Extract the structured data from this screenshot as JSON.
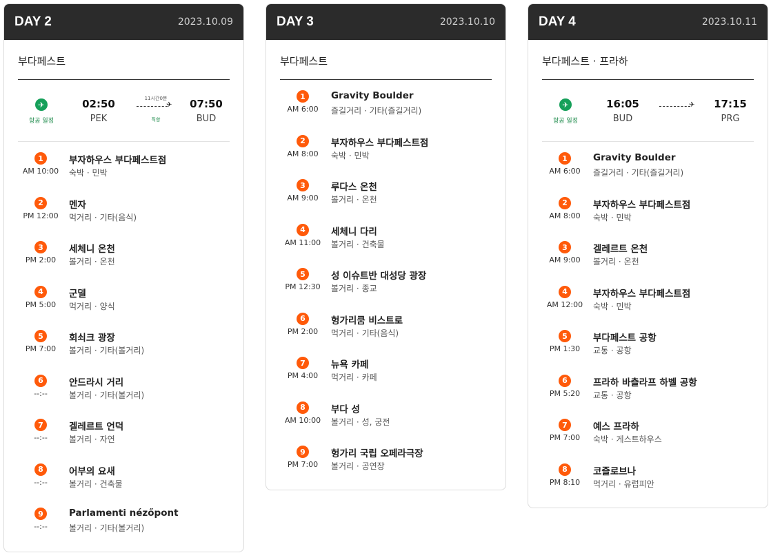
{
  "days": [
    {
      "day": "DAY 2",
      "date": "2023.10.09",
      "city": "부다페스트",
      "flight": {
        "label": "항공 일정",
        "dep_time": "02:50",
        "dep_code": "PEK",
        "arr_time": "07:50",
        "arr_code": "BUD",
        "duration": "11시간0분",
        "direct": "직항"
      },
      "stops": [
        {
          "num": "1",
          "time": "AM 10:00",
          "name": "부자하우스 부다페스트점",
          "category": "숙박 · 민박"
        },
        {
          "num": "2",
          "time": "PM 12:00",
          "name": "멘자",
          "category": "먹거리 · 기타(음식)"
        },
        {
          "num": "3",
          "time": "PM 2:00",
          "name": "세체니 온천",
          "category": "볼거리 · 온천"
        },
        {
          "num": "4",
          "time": "PM 5:00",
          "name": "군델",
          "category": "먹거리 · 양식"
        },
        {
          "num": "5",
          "time": "PM 7:00",
          "name": "회쇠크 광장",
          "category": "볼거리 · 기타(볼거리)"
        },
        {
          "num": "6",
          "time": "--:--",
          "name": "안드라시 거리",
          "category": "볼거리 · 기타(볼거리)"
        },
        {
          "num": "7",
          "time": "--:--",
          "name": "겔레르트 언덕",
          "category": "볼거리 · 자연"
        },
        {
          "num": "8",
          "time": "--:--",
          "name": "어부의 요새",
          "category": "볼거리 · 건축물"
        },
        {
          "num": "9",
          "time": "--:--",
          "name": "Parlamenti nézőpont",
          "category": "볼거리 · 기타(볼거리)"
        }
      ]
    },
    {
      "day": "DAY 3",
      "date": "2023.10.10",
      "city": "부다페스트",
      "stops": [
        {
          "num": "1",
          "time": "AM 6:00",
          "name": "Gravity Boulder",
          "category": "즐길거리 · 기타(즐길거리)"
        },
        {
          "num": "2",
          "time": "AM 8:00",
          "name": "부자하우스 부다페스트점",
          "category": "숙박 · 민박"
        },
        {
          "num": "3",
          "time": "AM 9:00",
          "name": "루다스 온천",
          "category": "볼거리 · 온천"
        },
        {
          "num": "4",
          "time": "AM 11:00",
          "name": "세체니 다리",
          "category": "볼거리 · 건축물"
        },
        {
          "num": "5",
          "time": "PM 12:30",
          "name": "성 이슈트반 대성당 광장",
          "category": "볼거리 · 종교"
        },
        {
          "num": "6",
          "time": "PM 2:00",
          "name": "헝가리쿰 비스트로",
          "category": "먹거리 · 기타(음식)"
        },
        {
          "num": "7",
          "time": "PM 4:00",
          "name": "뉴욕 카페",
          "category": "먹거리 · 카페"
        },
        {
          "num": "8",
          "time": "AM 10:00",
          "name": "부다 성",
          "category": "볼거리 · 성, 궁전"
        },
        {
          "num": "9",
          "time": "PM 7:00",
          "name": "헝가리 국립 오페라극장",
          "category": "볼거리 · 공연장"
        }
      ]
    },
    {
      "day": "DAY 4",
      "date": "2023.10.11",
      "city": "부다페스트 · 프라하",
      "flight": {
        "label": "항공 일정",
        "dep_time": "16:05",
        "dep_code": "BUD",
        "arr_time": "17:15",
        "arr_code": "PRG",
        "duration": "",
        "direct": ""
      },
      "stops": [
        {
          "num": "1",
          "time": "AM 6:00",
          "name": "Gravity Boulder",
          "category": "즐길거리 · 기타(즐길거리)"
        },
        {
          "num": "2",
          "time": "AM 8:00",
          "name": "부자하우스 부다페스트점",
          "category": "숙박 · 민박"
        },
        {
          "num": "3",
          "time": "AM 9:00",
          "name": "겔레르트 온천",
          "category": "볼거리 · 온천"
        },
        {
          "num": "4",
          "time": "AM 12:00",
          "name": "부자하우스 부다페스트점",
          "category": "숙박 · 민박"
        },
        {
          "num": "5",
          "time": "PM 1:30",
          "name": "부다페스트 공항",
          "category": "교통 · 공항"
        },
        {
          "num": "6",
          "time": "PM 5:20",
          "name": "프라하 바츨라프 하벨 공항",
          "category": "교통 · 공항"
        },
        {
          "num": "7",
          "time": "PM 7:00",
          "name": "예스 프라하",
          "category": "숙박 · 게스트하우스"
        },
        {
          "num": "8",
          "time": "PM 8:10",
          "name": "코즐로브나",
          "category": "먹거리 · 유럽피안"
        }
      ]
    }
  ]
}
